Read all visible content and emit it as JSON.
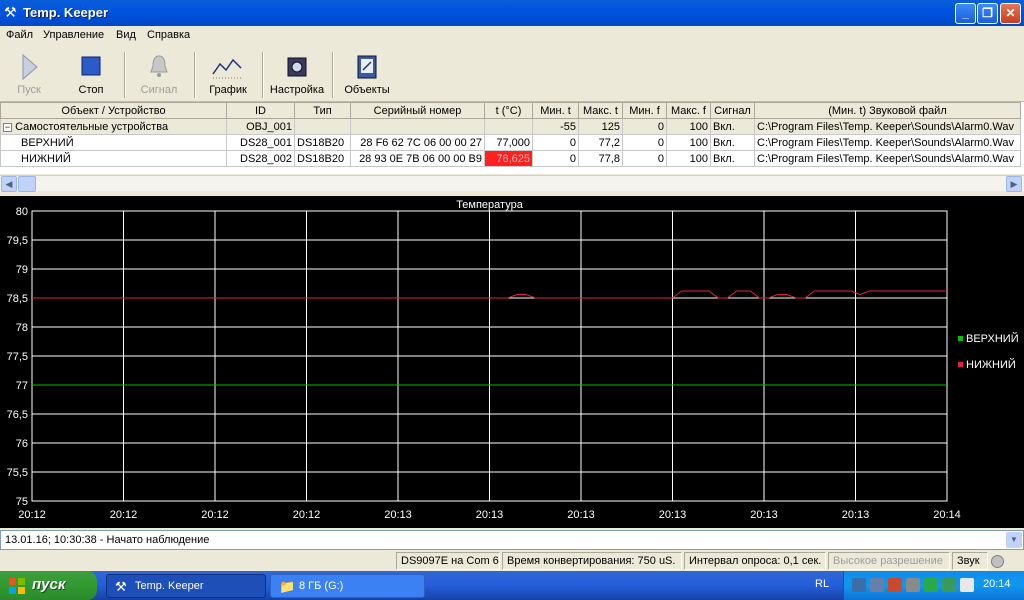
{
  "window": {
    "title": "Temp. Keeper",
    "min_glyph": "_",
    "max_glyph": "❐",
    "close_glyph": "✕"
  },
  "menu": [
    "Файл",
    "Управление",
    "Вид",
    "Справка"
  ],
  "toolbar": [
    {
      "label": "Пуск",
      "icon": "play-icon",
      "enabled": false
    },
    {
      "label": "Стоп",
      "icon": "stop-icon",
      "enabled": true
    },
    {
      "label": "Сигнал",
      "icon": "bell-icon",
      "enabled": false
    },
    {
      "label": "График",
      "icon": "chart-icon",
      "enabled": true
    },
    {
      "label": "Настройка",
      "icon": "settings-icon",
      "enabled": true
    },
    {
      "label": "Объекты",
      "icon": "objects-icon",
      "enabled": true
    }
  ],
  "grid": {
    "columns": [
      "Объект / Устройство",
      "ID",
      "Тип",
      "Серийный номер",
      "t (°C)",
      "Мин. t",
      "Макс. t",
      "Мин. f",
      "Макс. f",
      "Сигнал",
      "(Мин. t) Звуковой файл"
    ],
    "expander": "−",
    "rows": [
      {
        "name": "Самостоятельные устройства",
        "id": "OBJ_001",
        "type": "",
        "serial": "",
        "temp": "",
        "min_t": "-55",
        "max_t": "125",
        "min_f": "0",
        "max_f": "100",
        "signal": "Вкл.",
        "sound": "C:\\Program Files\\Temp. Keeper\\Sounds\\Alarm0.Wav"
      },
      {
        "name": "ВЕРХНИЙ",
        "id": "DS28_001",
        "type": "DS18B20",
        "serial": "28 F6 62 7C 06 00 00 27",
        "temp": "77,000",
        "min_t": "0",
        "max_t": "77,2",
        "min_f": "0",
        "max_f": "100",
        "signal": "Вкл.",
        "sound": "C:\\Program Files\\Temp. Keeper\\Sounds\\Alarm0.Wav"
      },
      {
        "name": "НИЖНИЙ",
        "id": "DS28_002",
        "type": "DS18B20",
        "serial": "28 93 0E 7B 06 00 00 B9",
        "temp": "78,625",
        "min_t": "0",
        "max_t": "77,8",
        "min_f": "0",
        "max_f": "100",
        "signal": "Вкл.",
        "sound": "C:\\Program Files\\Temp. Keeper\\Sounds\\Alarm0.Wav"
      }
    ]
  },
  "chart_data": {
    "type": "line",
    "title": "Температура",
    "xlabel": "",
    "ylabel": "",
    "ylim": [
      75,
      80
    ],
    "y_ticks": [
      "80",
      "79,5",
      "79",
      "78,5",
      "78",
      "77,5",
      "77",
      "76,5",
      "76",
      "75,5",
      "75"
    ],
    "x_ticks": [
      "20:12",
      "20:12",
      "20:12",
      "20:12",
      "20:13",
      "20:13",
      "20:13",
      "20:13",
      "20:13",
      "20:13",
      "20:14"
    ],
    "x_range": [
      0,
      10
    ],
    "grid": true,
    "legend_position": "right",
    "series": [
      {
        "name": "ВЕРХНИЙ",
        "color": "#00c000",
        "points": [
          [
            0,
            77.0
          ],
          [
            10,
            77.0
          ]
        ]
      },
      {
        "name": "НИЖНИЙ",
        "color": "#e0203c",
        "points": [
          [
            0,
            78.5
          ],
          [
            5.2,
            78.5
          ],
          [
            5.3,
            78.56
          ],
          [
            5.4,
            78.56
          ],
          [
            5.5,
            78.5
          ],
          [
            7.0,
            78.5
          ],
          [
            7.1,
            78.62
          ],
          [
            7.4,
            78.62
          ],
          [
            7.5,
            78.5
          ],
          [
            7.6,
            78.5
          ],
          [
            7.7,
            78.62
          ],
          [
            7.85,
            78.62
          ],
          [
            7.95,
            78.5
          ],
          [
            8.05,
            78.5
          ],
          [
            8.15,
            78.56
          ],
          [
            8.25,
            78.56
          ],
          [
            8.35,
            78.5
          ],
          [
            8.45,
            78.5
          ],
          [
            8.55,
            78.62
          ],
          [
            8.95,
            78.62
          ],
          [
            9.05,
            78.56
          ],
          [
            9.15,
            78.62
          ],
          [
            10,
            78.62
          ]
        ]
      }
    ]
  },
  "log": {
    "text": "13.01.16; 10:30:38 - Начато наблюдение"
  },
  "status": {
    "adapter": "DS9097E на Com 6",
    "conversion": "Время конвертирования: 750 uS.",
    "interval": "Интервал опроса: 0,1 сек.",
    "resolution": "Высокое разрешение",
    "sound": "Звук"
  },
  "taskbar": {
    "start": "пуск",
    "tasks": [
      "Temp. Keeper",
      "8 ГБ (G:)"
    ],
    "lang": "RL",
    "clock": "20:14"
  }
}
